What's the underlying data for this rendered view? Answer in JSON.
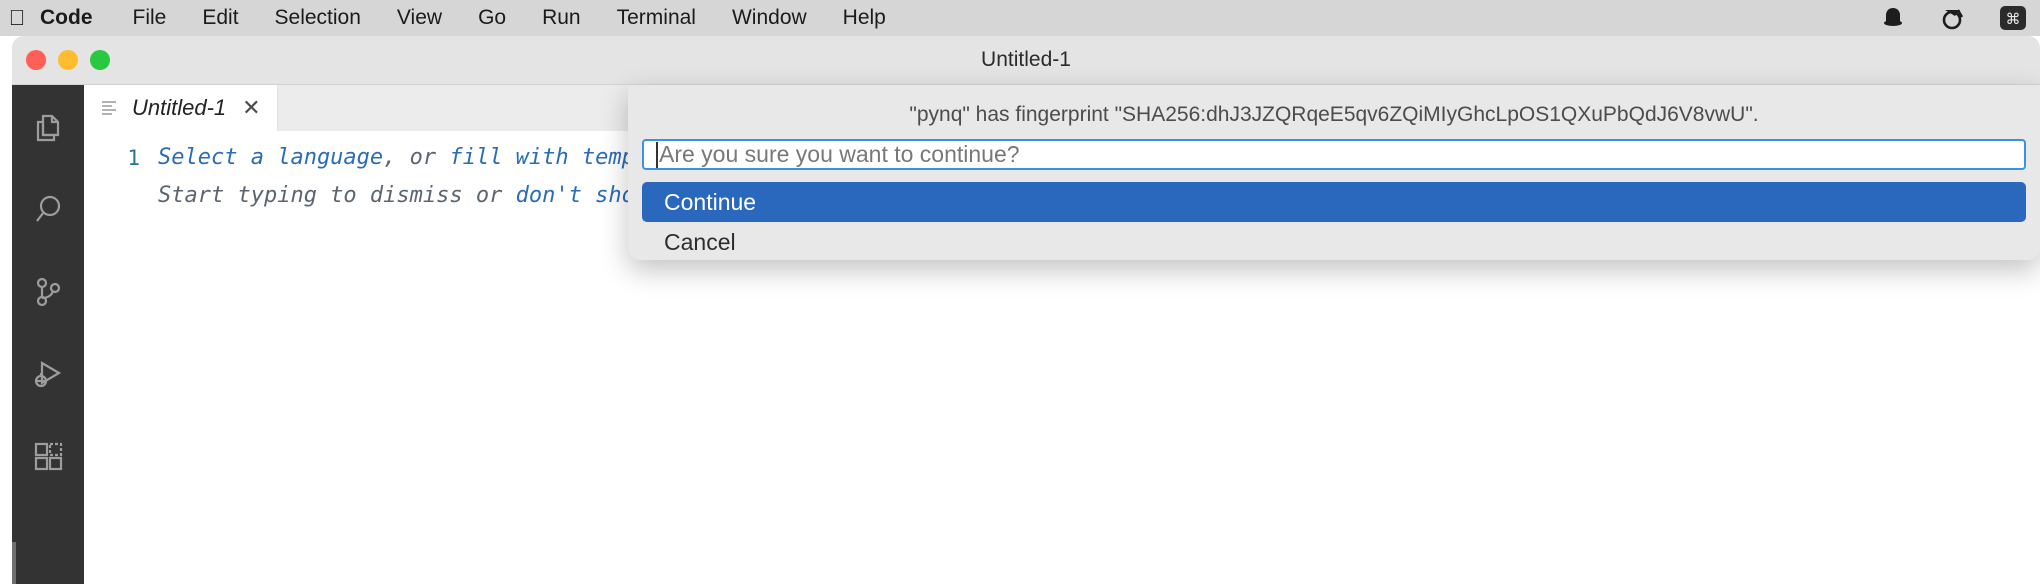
{
  "menubar": {
    "apple_icon": "apple-logo-icon",
    "items": [
      {
        "label": "Code",
        "bold": true
      },
      {
        "label": "File",
        "bold": false
      },
      {
        "label": "Edit",
        "bold": false
      },
      {
        "label": "Selection",
        "bold": false
      },
      {
        "label": "View",
        "bold": false
      },
      {
        "label": "Go",
        "bold": false
      },
      {
        "label": "Run",
        "bold": false
      },
      {
        "label": "Terminal",
        "bold": false
      },
      {
        "label": "Window",
        "bold": false
      },
      {
        "label": "Help",
        "bold": false
      }
    ],
    "status_icons": [
      "bell-icon",
      "clock-icon",
      "command-key-icon"
    ]
  },
  "window": {
    "title": "Untitled-1",
    "traffic_lights": {
      "close": "close-window-button",
      "minimize": "minimize-window-button",
      "zoom": "zoom-window-button"
    }
  },
  "activitybar": {
    "items": [
      {
        "name": "explorer",
        "icon": "files-icon"
      },
      {
        "name": "search",
        "icon": "search-icon"
      },
      {
        "name": "source-control",
        "icon": "source-control-branch-icon"
      },
      {
        "name": "run-and-debug",
        "icon": "run-debug-icon"
      },
      {
        "name": "extensions",
        "icon": "extensions-icon"
      }
    ]
  },
  "editor": {
    "tab": {
      "label": "Untitled-1",
      "icon": "file-lines-icon",
      "close_glyph": "✕"
    },
    "line_number": "1",
    "lines": [
      {
        "segments": [
          {
            "text": "Select a language",
            "style": "link"
          },
          {
            "text": ", or ",
            "style": "plain"
          },
          {
            "text": "fill with template",
            "style": "link"
          }
        ]
      },
      {
        "segments": [
          {
            "text": "Start typing to dismiss or ",
            "style": "plain"
          },
          {
            "text": "don't show this",
            "style": "link"
          }
        ]
      }
    ]
  },
  "dialog": {
    "message": "\"pynq\" has fingerprint \"SHA256:dhJ3JZQRqeE5qv6ZQiMIyGhcLpOS1QXuPbQdJ6V8vwU\".",
    "input_placeholder": "Are you sure you want to continue?",
    "input_value": "",
    "options": [
      {
        "label": "Continue",
        "selected": true
      },
      {
        "label": "Cancel",
        "selected": false
      }
    ],
    "accent_color": "#2a68bd",
    "focus_border_color": "#3d90e3"
  }
}
